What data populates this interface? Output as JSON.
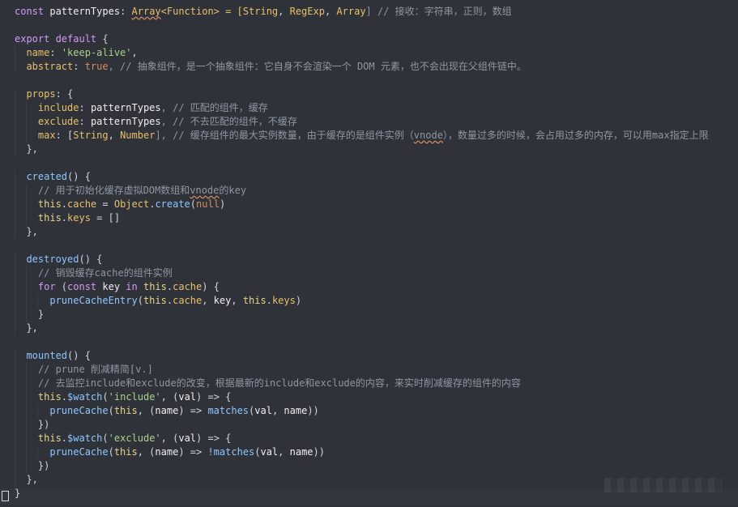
{
  "editor": {
    "lines": [
      {
        "parts": [
          {
            "t": "const ",
            "c": "tok-kw"
          },
          {
            "t": "patternTypes",
            "c": "tok-var"
          },
          {
            "t": ": ",
            "c": "tok-punct"
          },
          {
            "t": "Array",
            "c": "tok-type tok-warn"
          },
          {
            "t": "<Function> = [",
            "c": "tok-type"
          },
          {
            "t": "String",
            "c": "tok-type"
          },
          {
            "t": ", ",
            "c": "tok-punct"
          },
          {
            "t": "RegExp",
            "c": "tok-type"
          },
          {
            "t": ", ",
            "c": "tok-punct"
          },
          {
            "t": "Array",
            "c": "tok-type"
          },
          {
            "t": "] // 接收：字符串，正则，数组",
            "c": "tok-comment"
          }
        ]
      },
      {
        "parts": []
      },
      {
        "parts": [
          {
            "t": "export default ",
            "c": "tok-kw"
          },
          {
            "t": "{",
            "c": "tok-punct"
          }
        ]
      },
      {
        "parts": [
          {
            "t": "  name",
            "c": "tok-prop"
          },
          {
            "t": ": ",
            "c": "tok-punct"
          },
          {
            "t": "'keep-alive'",
            "c": "tok-str"
          },
          {
            "t": ",",
            "c": "tok-punct"
          }
        ]
      },
      {
        "parts": [
          {
            "t": "  abstract",
            "c": "tok-prop"
          },
          {
            "t": ": ",
            "c": "tok-punct"
          },
          {
            "t": "true",
            "c": "tok-bool"
          },
          {
            "t": ", // 抽象组件，是一个抽象组件：它自身不会渲染一个 DOM 元素，也不会出现在父组件链中。",
            "c": "tok-comment"
          }
        ]
      },
      {
        "parts": []
      },
      {
        "parts": [
          {
            "t": "  props",
            "c": "tok-prop"
          },
          {
            "t": ": {",
            "c": "tok-punct"
          }
        ]
      },
      {
        "parts": [
          {
            "t": "    include",
            "c": "tok-prop"
          },
          {
            "t": ": ",
            "c": "tok-punct"
          },
          {
            "t": "patternTypes",
            "c": "tok-var"
          },
          {
            "t": ", // 匹配的组件，缓存",
            "c": "tok-comment"
          }
        ]
      },
      {
        "parts": [
          {
            "t": "    exclude",
            "c": "tok-prop"
          },
          {
            "t": ": ",
            "c": "tok-punct"
          },
          {
            "t": "patternTypes",
            "c": "tok-var"
          },
          {
            "t": ", // 不去匹配的组件，不缓存",
            "c": "tok-comment"
          }
        ]
      },
      {
        "parts": [
          {
            "t": "    max",
            "c": "tok-prop"
          },
          {
            "t": ": [",
            "c": "tok-punct"
          },
          {
            "t": "String",
            "c": "tok-type"
          },
          {
            "t": ", ",
            "c": "tok-punct"
          },
          {
            "t": "Number",
            "c": "tok-type"
          },
          {
            "t": "], // 缓存组件的最大实例数量，由于缓存的是组件实例（",
            "c": "tok-comment"
          },
          {
            "t": "vnode",
            "c": "tok-comment tok-warn"
          },
          {
            "t": "），数量过多的时候，会占用过多的内存，可以用max指定上限",
            "c": "tok-comment"
          }
        ]
      },
      {
        "parts": [
          {
            "t": "  },",
            "c": "tok-punct"
          }
        ]
      },
      {
        "parts": []
      },
      {
        "parts": [
          {
            "t": "  created",
            "c": "tok-fn"
          },
          {
            "t": "() {",
            "c": "tok-punct"
          }
        ]
      },
      {
        "parts": [
          {
            "t": "    // 用于初始化缓存虚拟DOM数组和",
            "c": "tok-comment"
          },
          {
            "t": "vnode",
            "c": "tok-comment tok-warn"
          },
          {
            "t": "的key",
            "c": "tok-comment"
          }
        ]
      },
      {
        "parts": [
          {
            "t": "    this",
            "c": "tok-this"
          },
          {
            "t": ".",
            "c": "tok-punct"
          },
          {
            "t": "cache",
            "c": "tok-prop"
          },
          {
            "t": " = ",
            "c": "tok-op"
          },
          {
            "t": "Object",
            "c": "tok-type"
          },
          {
            "t": ".",
            "c": "tok-punct"
          },
          {
            "t": "create",
            "c": "tok-fn"
          },
          {
            "t": "(",
            "c": "tok-punct"
          },
          {
            "t": "null",
            "c": "tok-bool"
          },
          {
            "t": ")",
            "c": "tok-punct"
          }
        ]
      },
      {
        "parts": [
          {
            "t": "    this",
            "c": "tok-this"
          },
          {
            "t": ".",
            "c": "tok-punct"
          },
          {
            "t": "keys",
            "c": "tok-prop"
          },
          {
            "t": " = []",
            "c": "tok-punct"
          }
        ]
      },
      {
        "parts": [
          {
            "t": "  },",
            "c": "tok-punct"
          }
        ]
      },
      {
        "parts": []
      },
      {
        "parts": [
          {
            "t": "  destroyed",
            "c": "tok-fn"
          },
          {
            "t": "() {",
            "c": "tok-punct"
          }
        ]
      },
      {
        "parts": [
          {
            "t": "    // 销毁缓存cache的组件实例",
            "c": "tok-comment"
          }
        ]
      },
      {
        "parts": [
          {
            "t": "    for ",
            "c": "tok-kw"
          },
          {
            "t": "(",
            "c": "tok-punct"
          },
          {
            "t": "const ",
            "c": "tok-kw"
          },
          {
            "t": "key ",
            "c": "tok-var"
          },
          {
            "t": "in ",
            "c": "tok-kw"
          },
          {
            "t": "this",
            "c": "tok-this"
          },
          {
            "t": ".",
            "c": "tok-punct"
          },
          {
            "t": "cache",
            "c": "tok-prop"
          },
          {
            "t": ") {",
            "c": "tok-punct"
          }
        ]
      },
      {
        "parts": [
          {
            "t": "      pruneCacheEntry",
            "c": "tok-fn"
          },
          {
            "t": "(",
            "c": "tok-punct"
          },
          {
            "t": "this",
            "c": "tok-this"
          },
          {
            "t": ".",
            "c": "tok-punct"
          },
          {
            "t": "cache",
            "c": "tok-prop"
          },
          {
            "t": ", ",
            "c": "tok-punct"
          },
          {
            "t": "key",
            "c": "tok-var"
          },
          {
            "t": ", ",
            "c": "tok-punct"
          },
          {
            "t": "this",
            "c": "tok-this"
          },
          {
            "t": ".",
            "c": "tok-punct"
          },
          {
            "t": "keys",
            "c": "tok-prop"
          },
          {
            "t": ")",
            "c": "tok-punct"
          }
        ]
      },
      {
        "parts": [
          {
            "t": "    }",
            "c": "tok-punct"
          }
        ]
      },
      {
        "parts": [
          {
            "t": "  },",
            "c": "tok-punct"
          }
        ]
      },
      {
        "parts": []
      },
      {
        "parts": [
          {
            "t": "  mounted",
            "c": "tok-fn"
          },
          {
            "t": "() {",
            "c": "tok-punct"
          }
        ]
      },
      {
        "parts": [
          {
            "t": "    // prune 削减精简[v.]",
            "c": "tok-comment"
          }
        ]
      },
      {
        "parts": [
          {
            "t": "    // 去监控include和exclude的改变，根据最新的include和exclude的内容，来实时削减缓存的组件的内容",
            "c": "tok-comment"
          }
        ]
      },
      {
        "parts": [
          {
            "t": "    this",
            "c": "tok-this"
          },
          {
            "t": ".",
            "c": "tok-punct"
          },
          {
            "t": "$watch",
            "c": "tok-fn"
          },
          {
            "t": "(",
            "c": "tok-punct"
          },
          {
            "t": "'include'",
            "c": "tok-str"
          },
          {
            "t": ", (",
            "c": "tok-punct"
          },
          {
            "t": "val",
            "c": "tok-var"
          },
          {
            "t": ") => {",
            "c": "tok-punct"
          }
        ]
      },
      {
        "parts": [
          {
            "t": "      pruneCache",
            "c": "tok-fn"
          },
          {
            "t": "(",
            "c": "tok-punct"
          },
          {
            "t": "this",
            "c": "tok-this"
          },
          {
            "t": ", (",
            "c": "tok-punct"
          },
          {
            "t": "name",
            "c": "tok-var"
          },
          {
            "t": ") => ",
            "c": "tok-punct"
          },
          {
            "t": "matches",
            "c": "tok-fn"
          },
          {
            "t": "(",
            "c": "tok-punct"
          },
          {
            "t": "val",
            "c": "tok-var"
          },
          {
            "t": ", ",
            "c": "tok-punct"
          },
          {
            "t": "name",
            "c": "tok-var"
          },
          {
            "t": "))",
            "c": "tok-punct"
          }
        ]
      },
      {
        "parts": [
          {
            "t": "    })",
            "c": "tok-punct"
          }
        ]
      },
      {
        "parts": [
          {
            "t": "    this",
            "c": "tok-this"
          },
          {
            "t": ".",
            "c": "tok-punct"
          },
          {
            "t": "$watch",
            "c": "tok-fn"
          },
          {
            "t": "(",
            "c": "tok-punct"
          },
          {
            "t": "'exclude'",
            "c": "tok-str"
          },
          {
            "t": ", (",
            "c": "tok-punct"
          },
          {
            "t": "val",
            "c": "tok-var"
          },
          {
            "t": ") => {",
            "c": "tok-punct"
          }
        ]
      },
      {
        "parts": [
          {
            "t": "      pruneCache",
            "c": "tok-fn"
          },
          {
            "t": "(",
            "c": "tok-punct"
          },
          {
            "t": "this",
            "c": "tok-this"
          },
          {
            "t": ", (",
            "c": "tok-punct"
          },
          {
            "t": "name",
            "c": "tok-var"
          },
          {
            "t": ") => ",
            "c": "tok-punct"
          },
          {
            "t": "!matches",
            "c": "tok-fn"
          },
          {
            "t": "(",
            "c": "tok-punct"
          },
          {
            "t": "val",
            "c": "tok-var"
          },
          {
            "t": ", ",
            "c": "tok-punct"
          },
          {
            "t": "name",
            "c": "tok-var"
          },
          {
            "t": "))",
            "c": "tok-punct"
          }
        ]
      },
      {
        "parts": [
          {
            "t": "    })",
            "c": "tok-punct"
          }
        ]
      },
      {
        "parts": [
          {
            "t": "  },",
            "c": "tok-punct"
          }
        ]
      },
      {
        "parts": [
          {
            "t": "}",
            "c": "tok-punct"
          }
        ]
      }
    ]
  }
}
